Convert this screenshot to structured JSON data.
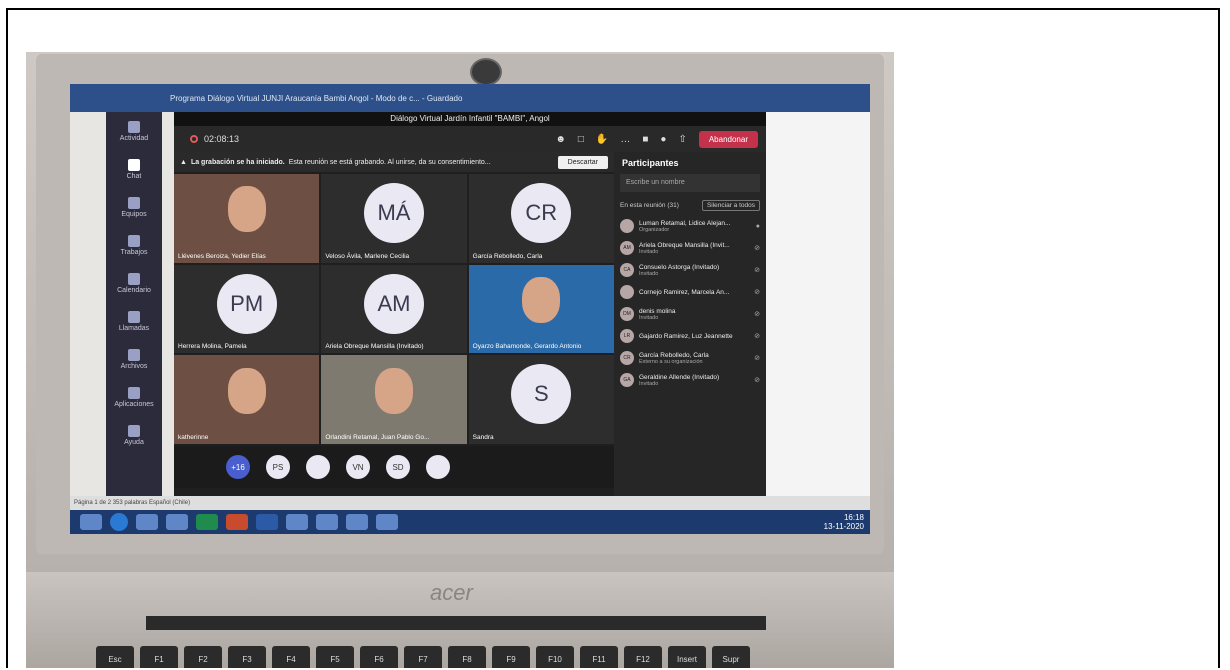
{
  "meeting": {
    "window_title": "Diálogo Virtual Jardín Infantil \"BAMBI\", Angol",
    "timer": "02:08:13",
    "leave_label": "Abandonar"
  },
  "banner": {
    "heading": "La grabación se ha iniciado.",
    "text": "Esta reunión se está grabando. Al unirse, da su consentimiento...",
    "dismiss_label": "Descartar"
  },
  "rail": [
    {
      "label": "Actividad"
    },
    {
      "label": "Chat"
    },
    {
      "label": "Equipos"
    },
    {
      "label": "Trabajos"
    },
    {
      "label": "Calendario"
    },
    {
      "label": "Llamadas"
    },
    {
      "label": "Archivos"
    },
    {
      "label": "Aplicaciones"
    },
    {
      "label": "Ayuda"
    }
  ],
  "tiles": [
    {
      "initials": "",
      "name": "Llévenes Beroiza, Yedier Elías",
      "kind": "video"
    },
    {
      "initials": "MÁ",
      "name": "Veloso Ávila, Marlene Cecilia"
    },
    {
      "initials": "CR",
      "name": "García Rebolledo, Carla"
    },
    {
      "initials": "PM",
      "name": "Herrera Molina, Pamela"
    },
    {
      "initials": "AM",
      "name": "Ariela Obreque Mansilla (Invitado)"
    },
    {
      "initials": "",
      "name": "Oyarzo Bahamonde, Gerardo Antonio",
      "kind": "video3"
    },
    {
      "initials": "",
      "name": "katherinne",
      "kind": "video"
    },
    {
      "initials": "",
      "name": "Orlandini Retamal, Juan Pablo Go...",
      "kind": "video2"
    },
    {
      "initials": "S",
      "name": "Sandra"
    }
  ],
  "strip": [
    "+16",
    "PS",
    "",
    "VN",
    "SD",
    ""
  ],
  "participants": {
    "title": "Participantes",
    "search_placeholder": "Escribe un nombre",
    "section_label": "En esta reunión (31)",
    "mute_all_label": "Silenciar a todos",
    "list": [
      {
        "initials": "",
        "name": "Luman Retamal, Lidice Alejan...",
        "role": "Organizador"
      },
      {
        "initials": "AM",
        "name": "Ariela Obreque Mansilla (Invit...",
        "role": "Invitado"
      },
      {
        "initials": "CA",
        "name": "Consuelo Astorga (Invitado)",
        "role": "Invitado"
      },
      {
        "initials": "",
        "name": "Cornejo Ramirez, Marcela An...",
        "role": ""
      },
      {
        "initials": "DM",
        "name": "denis molina",
        "role": "Invitado"
      },
      {
        "initials": "LR",
        "name": "Gajardo Ramirez, Luz Jeannette",
        "role": ""
      },
      {
        "initials": "CR",
        "name": "García Rebolledo, Carla",
        "role": "Externo a su organización"
      },
      {
        "initials": "GA",
        "name": "Geraldine Allende (Invitado)",
        "role": "Invitado"
      }
    ]
  },
  "word": {
    "title": "Programa Diálogo Virtual JUNJI Araucanía Bambi Angol - Modo de c... - Guardado",
    "status": "Página 1 de 2   353 palabras   Español (Chile)"
  },
  "taskbar": {
    "time": "16:18",
    "date": "13-11-2020"
  },
  "keyboard": {
    "brand": "acer",
    "keys": [
      "Esc",
      "F1",
      "F2",
      "F3",
      "F4",
      "F5",
      "F6",
      "F7",
      "F8",
      "F9",
      "F10",
      "F11",
      "F12",
      "Insert",
      "Supr"
    ]
  },
  "colors": {
    "teams_bg": "#1f1f1f",
    "leave_red": "#c4314b",
    "taskbar": "#1d3a6e"
  }
}
